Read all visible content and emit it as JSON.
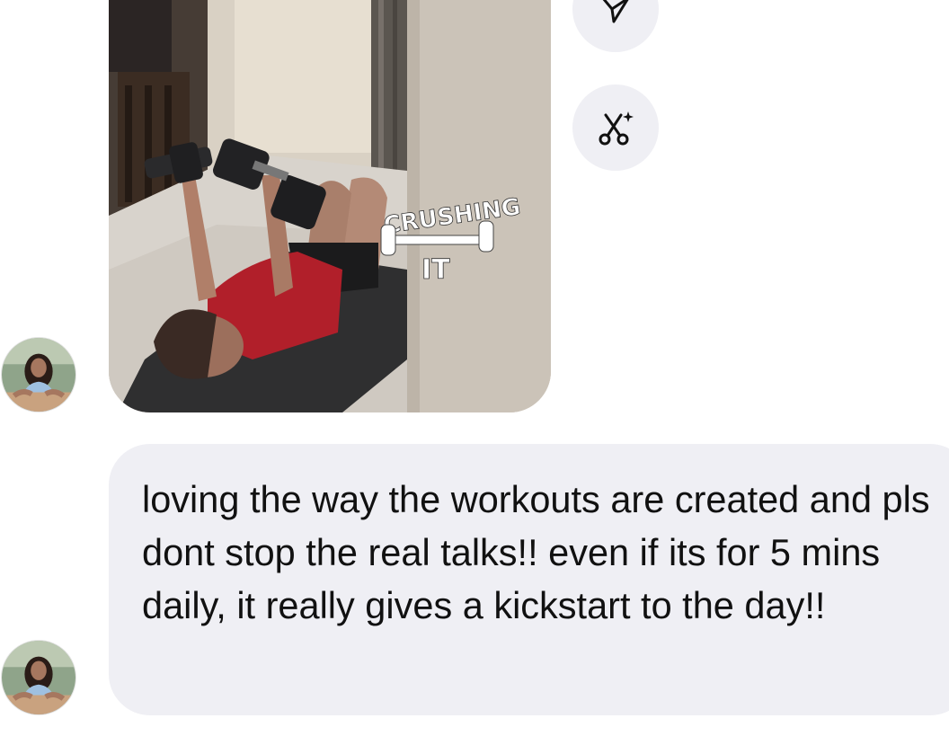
{
  "conversation": {
    "media_message": {
      "sticker_text_top": "CRUSHING",
      "sticker_text_bottom": "IT"
    },
    "side_actions": [
      {
        "icon": "send-icon"
      },
      {
        "icon": "scissors-sparkle-icon"
      }
    ],
    "text_message": {
      "text": "loving the way the workouts are created and pls dont stop the real talks!! even if its for 5 mins daily, it really gives a kickstart to the day!!"
    }
  },
  "colors": {
    "bubble_background": "#efeff4",
    "text": "#111111",
    "icon": "#111111"
  }
}
